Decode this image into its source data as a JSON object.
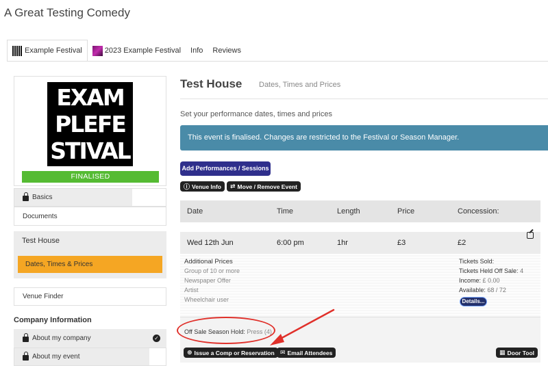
{
  "app": {
    "title": "A Great Testing Comedy"
  },
  "tabs": [
    {
      "label": "Example Festival",
      "thumb": "example-festival-thumb",
      "active": true
    },
    {
      "label": "2023 Example Festival",
      "thumb": "2023-festival-thumb",
      "active": false
    },
    {
      "label": "Info",
      "active": false
    },
    {
      "label": "Reviews",
      "active": false
    }
  ],
  "sidebar": {
    "logo_lines": [
      "EXAM",
      "PLEFE",
      "STIVAL"
    ],
    "status": "FINALISED",
    "basics": "Basics",
    "documents": "Documents",
    "group_title": "Test House",
    "active_item": "Dates, Times & Prices",
    "venue_finder": "Venue Finder",
    "section_title": "Company Information",
    "about_company": "About my company",
    "about_event": "About my event"
  },
  "main": {
    "title": "Test House",
    "subtitle": "Dates, Times and Prices",
    "intro": "Set your performance dates, times and prices",
    "alert": "This event is finalised. Changes are restricted to the Festival or Season Manager.",
    "add_button": "Add Performances / Sessions",
    "venue_info_button": "Venue Info",
    "move_button": "Move / Remove Event"
  },
  "table": {
    "headers": {
      "date": "Date",
      "time": "Time",
      "length": "Length",
      "price": "Price",
      "concession": "Concession:"
    },
    "row": {
      "date": "Wed 12th Jun",
      "time": "6:00 pm",
      "length": "1hr",
      "price": "£3",
      "concession": "£2"
    },
    "additional_prices": {
      "title": "Additional Prices",
      "items": [
        "Group of 10 or more",
        "Newspaper Offer",
        "Artist",
        "Wheelchair user"
      ]
    },
    "stats": {
      "sold_label": "Tickets Sold:",
      "held_label": "Tickets Held Off Sale:",
      "held_value": "4",
      "income_label": "Income:",
      "income_value": "£ 0.00",
      "available_label": "Available:",
      "available_value": "68 / 72"
    },
    "details_button": "Details...",
    "hold_label": "Off Sale Season Hold:",
    "hold_value": "Press (4)",
    "comp_button": "Issue a Comp or Reservation",
    "email_button": "Email Attendees",
    "door_button": "Door Tool"
  },
  "colors": {
    "accent": "#f5a623",
    "alert": "#4a8ba8",
    "primary_button": "#2f2f8c",
    "status": "#55bb33",
    "annotation": "#e0302a"
  }
}
